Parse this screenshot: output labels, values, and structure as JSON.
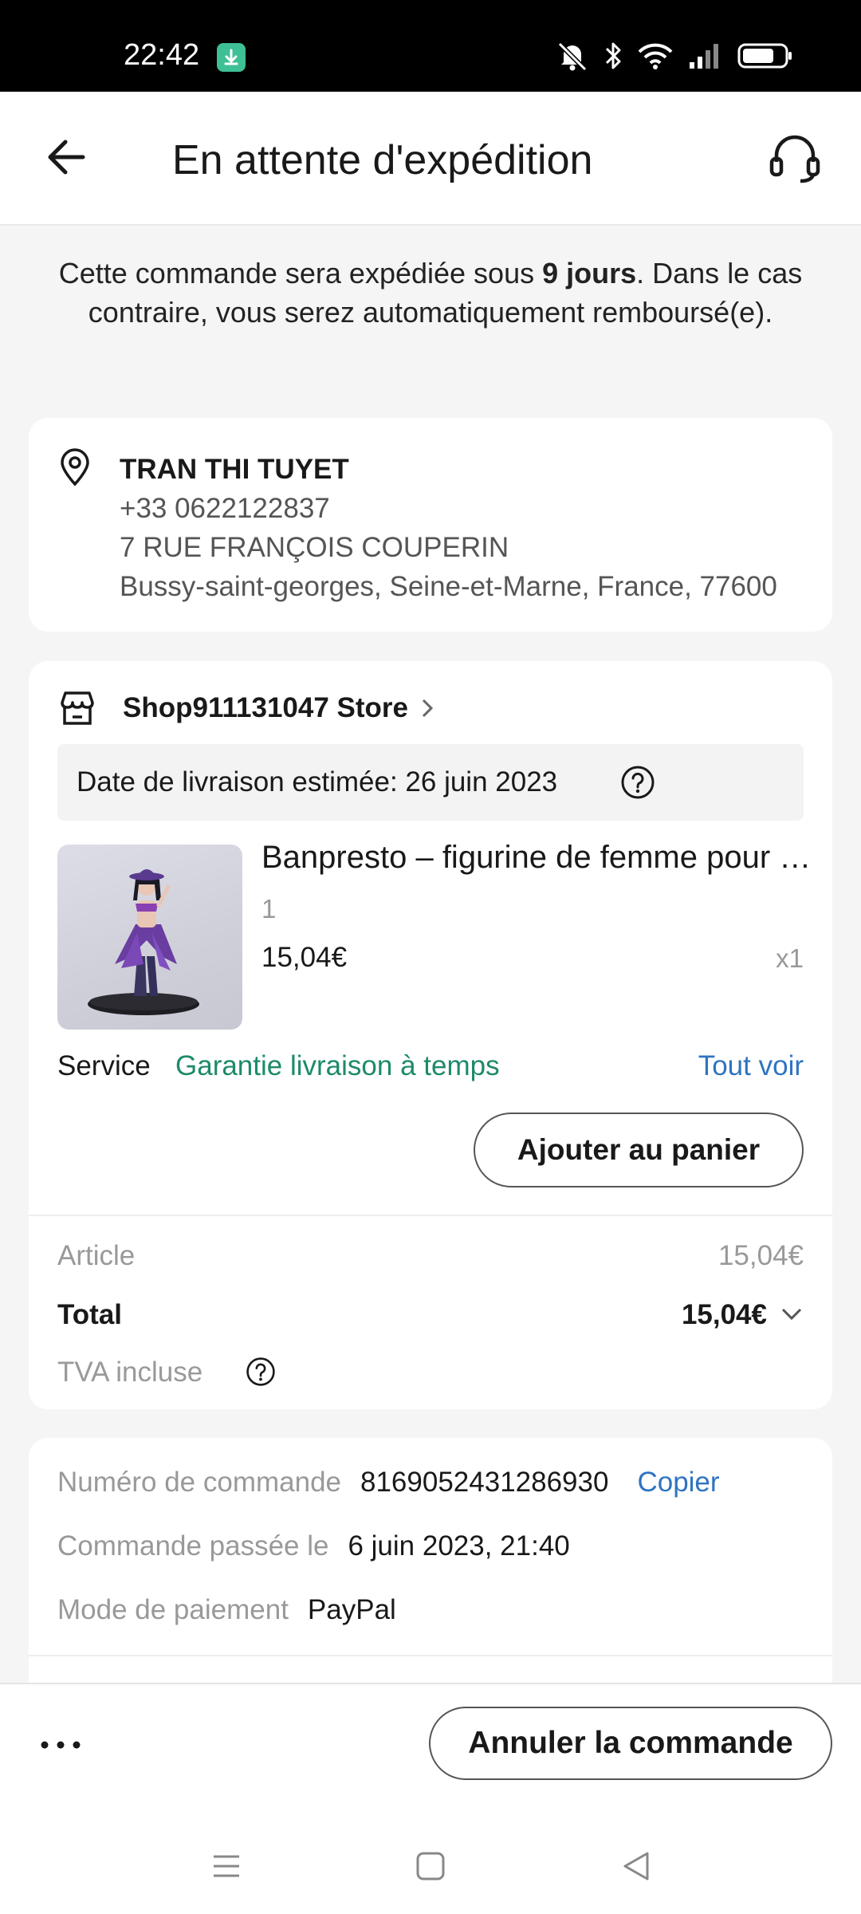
{
  "status_bar": {
    "time": "22:42",
    "icons": [
      "download-notification-icon",
      "mute-icon",
      "bluetooth-icon",
      "wifi-icon",
      "signal-icon",
      "battery-icon"
    ]
  },
  "header": {
    "title": "En attente d'expédition",
    "back_icon": "arrow-left-icon",
    "support_icon": "headset-icon"
  },
  "notice": {
    "before": "Cette commande sera expédiée sous ",
    "bold": "9 jours",
    "after": ". Dans le cas contraire, vous serez automatiquement remboursé(e)."
  },
  "address": {
    "name": "TRAN THI TUYET",
    "phone": "+33 0622122837",
    "street": "7 RUE FRANÇOIS COUPERIN",
    "city": "Bussy-saint-georges, Seine-et-Marne, France, 77600"
  },
  "order": {
    "store_name": "Shop911131047 Store",
    "delivery_estimate": "Date de livraison estimée: 26 juin 2023",
    "product": {
      "title": "Banpresto – figurine de femme pour collection",
      "variant": "1",
      "price": "15,04€",
      "quantity": "x1"
    },
    "service": {
      "label": "Service",
      "value": "Garantie livraison à temps",
      "see_all": "Tout voir"
    },
    "add_to_cart_label": "Ajouter au panier",
    "summary": {
      "article_label": "Article",
      "article_value": "15,04€",
      "total_label": "Total",
      "total_value": "15,04€",
      "tva_label": "TVA incluse"
    }
  },
  "order_info": {
    "number_label": "Numéro de commande",
    "number_value": "8169052431286930",
    "copy_label": "Copier",
    "placed_label": "Commande passée le",
    "placed_value": "6 juin 2023, 21:40",
    "payment_label": "Mode de paiement",
    "payment_value": "PayPal"
  },
  "bottom": {
    "cancel_label": "Annuler la commande"
  },
  "colors": {
    "accent_green": "#1d8a6a",
    "link_blue": "#2f74c0",
    "muted_gray": "#999999"
  }
}
